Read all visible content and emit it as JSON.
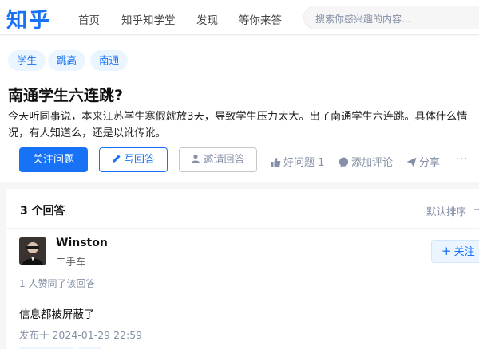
{
  "colors": {
    "brand": "#1772f6",
    "tag_bg": "#ebf5ff",
    "muted": "#8590a6"
  },
  "nav": {
    "logo": "知乎",
    "items": [
      {
        "label": "首页"
      },
      {
        "label": "知乎知学堂"
      },
      {
        "label": "发现"
      },
      {
        "label": "等你来答"
      }
    ],
    "search_placeholder": "搜索你感兴趣的内容..."
  },
  "question": {
    "tags": [
      {
        "label": "学生"
      },
      {
        "label": "跳高"
      },
      {
        "label": "南通"
      }
    ],
    "title": "南通学生六连跳?",
    "description": "今天听同事说，本来江苏学生寒假就放3天，导致学生压力太大。出了南通学生六连跳。具体什么情况，有人知道么，还是以讹传讹。",
    "follow_label": "关注问题",
    "write_label": "写回答",
    "invite_label": "邀请回答",
    "good_question_label": "好问题 1",
    "comment_label": "添加评论",
    "share_label": "分享",
    "more_label": "···"
  },
  "answers": {
    "count_label": "3 个回答",
    "sort_label": "默认排序",
    "items": [
      {
        "author": "Winston",
        "author_sub": "二手车",
        "follow_label": "关注",
        "agree_text": "1 人赞同了该回答",
        "content": "信息都被屏蔽了",
        "published": "发布于 2024-01-29 22:59"
      }
    ]
  }
}
